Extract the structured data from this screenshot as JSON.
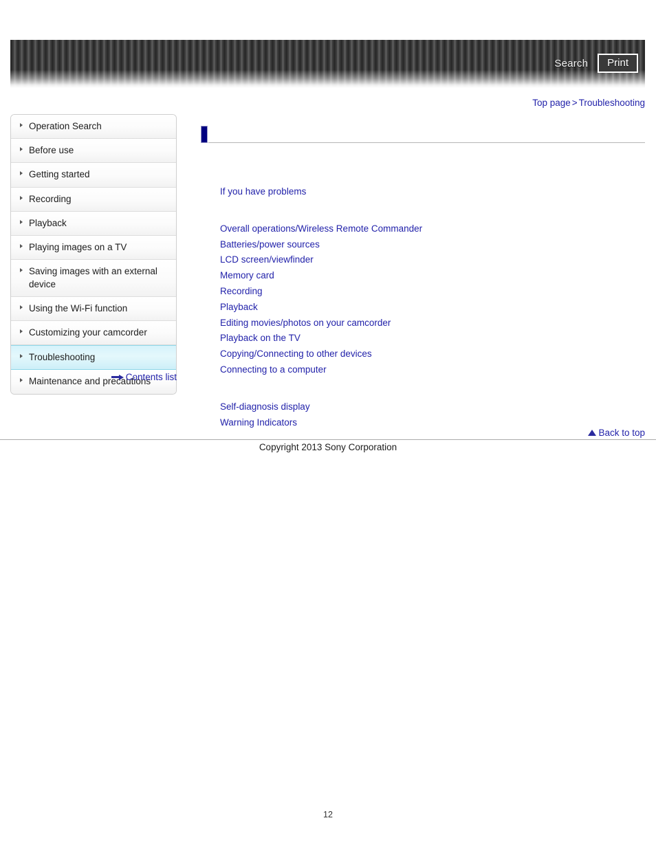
{
  "header": {
    "search_label": "Search",
    "print_label": "Print",
    "search_icon": "search-icon",
    "print_icon": "print-icon"
  },
  "breadcrumb": {
    "top_page": "Top page",
    "separator": ">",
    "current": "Troubleshooting"
  },
  "sidebar": {
    "items": [
      {
        "label": "Operation Search",
        "active": false
      },
      {
        "label": "Before use",
        "active": false
      },
      {
        "label": "Getting started",
        "active": false
      },
      {
        "label": "Recording",
        "active": false
      },
      {
        "label": "Playback",
        "active": false
      },
      {
        "label": "Playing images on a TV",
        "active": false
      },
      {
        "label": "Saving images with an external device",
        "active": false
      },
      {
        "label": "Using the Wi-Fi function",
        "active": false
      },
      {
        "label": "Customizing your camcorder",
        "active": false
      },
      {
        "label": "Troubleshooting",
        "active": true
      },
      {
        "label": "Maintenance and precautions",
        "active": false
      }
    ],
    "contents_list_label": "Contents list",
    "contents_list_icon": "arrow-right-icon"
  },
  "content": {
    "title": "",
    "intro_links": [
      "If you have problems"
    ],
    "main_links": [
      "Overall operations/Wireless Remote Commander",
      "Batteries/power sources",
      "LCD screen/viewfinder",
      "Memory card",
      "Recording",
      "Playback",
      "Editing movies/photos on your camcorder",
      "Playback on the TV",
      "Copying/Connecting to other devices",
      "Connecting to a computer"
    ],
    "diagnostic_links": [
      "Self-diagnosis display",
      "Warning Indicators"
    ]
  },
  "footer": {
    "back_to_top_label": "Back to top",
    "back_to_top_icon": "triangle-up-icon",
    "copyright": "Copyright 2013 Sony Corporation",
    "page_number": "12"
  },
  "colors": {
    "link": "#2222aa",
    "title_marker": "#000080",
    "active_item": "#d6f3fb",
    "header_stripe_dark": "#2b2b2b",
    "header_stripe_light": "#565656"
  }
}
